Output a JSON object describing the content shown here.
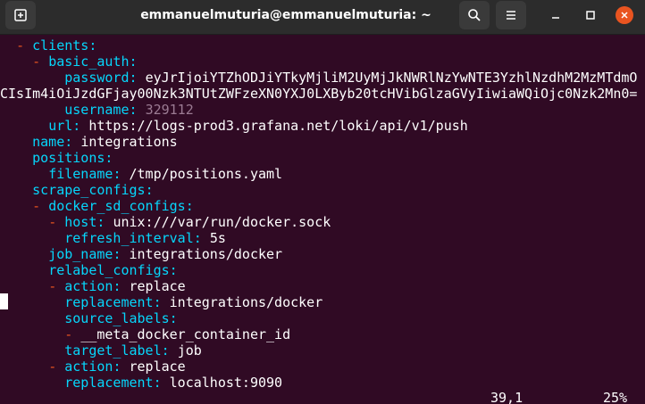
{
  "window": {
    "title": "emmanuelmuturia@emmanuelmuturia: ~"
  },
  "editor": {
    "lines": [
      {
        "indent": "  ",
        "dash": "- ",
        "key": "clients",
        "sep": ":",
        "value": ""
      },
      {
        "indent": "    ",
        "dash": "- ",
        "key": "basic_auth",
        "sep": ":",
        "value": ""
      },
      {
        "indent": "        ",
        "dash": "",
        "key": "password",
        "sep": ": ",
        "value": "eyJrIjoiYTZhODJiYTkyMjliM2UyMjJkNWRlNzYwNTE3YzhlNzdhM2MzMTdmO"
      },
      {
        "indent": "",
        "dash": "",
        "key": "",
        "sep": "",
        "value": "CIsIm4iOiJzdGFjay00Nzk3NTUtZWFzeXN0YXJ0LXByb20tcHVibGlzaGVyIiwiaWQiOjc0Nzk2Mn0="
      },
      {
        "indent": "        ",
        "dash": "",
        "key": "username",
        "sep": ": ",
        "value": "329112",
        "valueClass": "num"
      },
      {
        "indent": "      ",
        "dash": "",
        "key": "url",
        "sep": ": ",
        "value": "https://logs-prod3.grafana.net/loki/api/v1/push"
      },
      {
        "indent": "    ",
        "dash": "",
        "key": "name",
        "sep": ": ",
        "value": "integrations"
      },
      {
        "indent": "    ",
        "dash": "",
        "key": "positions",
        "sep": ":",
        "value": ""
      },
      {
        "indent": "      ",
        "dash": "",
        "key": "filename",
        "sep": ": ",
        "value": "/tmp/positions.yaml"
      },
      {
        "indent": "    ",
        "dash": "",
        "key": "scrape_configs",
        "sep": ":",
        "value": ""
      },
      {
        "indent": "    ",
        "dash": "- ",
        "key": "docker_sd_configs",
        "sep": ":",
        "value": ""
      },
      {
        "indent": "      ",
        "dash": "- ",
        "key": "host",
        "sep": ": ",
        "value": "unix:///var/run/docker.sock"
      },
      {
        "indent": "        ",
        "dash": "",
        "key": "refresh_interval",
        "sep": ": ",
        "value": "5s"
      },
      {
        "indent": "      ",
        "dash": "",
        "key": "job_name",
        "sep": ": ",
        "value": "integrations/docker"
      },
      {
        "indent": "      ",
        "dash": "",
        "key": "relabel_configs",
        "sep": ":",
        "value": ""
      },
      {
        "indent": "      ",
        "dash": "- ",
        "key": "action",
        "sep": ": ",
        "value": "replace"
      },
      {
        "indent": "        ",
        "dash": "",
        "key": "replacement",
        "sep": ": ",
        "value": "integrations/docker"
      },
      {
        "indent": "        ",
        "dash": "",
        "key": "source_labels",
        "sep": ":",
        "value": ""
      },
      {
        "indent": "        ",
        "dash": "- ",
        "key": "",
        "sep": "",
        "value": "__meta_docker_container_id"
      },
      {
        "indent": "        ",
        "dash": "",
        "key": "target_label",
        "sep": ": ",
        "value": "job"
      },
      {
        "indent": "      ",
        "dash": "- ",
        "key": "action",
        "sep": ": ",
        "value": "replace"
      },
      {
        "indent": "        ",
        "dash": "",
        "key": "replacement",
        "sep": ": ",
        "value": "localhost:9090"
      }
    ]
  },
  "status": {
    "position": "39,1",
    "percent": "25%"
  },
  "icons": {
    "new_tab": "new-tab-icon",
    "search": "search-icon",
    "menu": "hamburger-menu-icon",
    "minimize": "minimize-icon",
    "maximize": "maximize-icon",
    "close": "close-icon"
  },
  "colors": {
    "background": "#300a24",
    "key": "#06d6fb",
    "dash": "#e95420",
    "number": "#9b7b93",
    "text": "#ffffff",
    "close_button": "#e95420"
  }
}
